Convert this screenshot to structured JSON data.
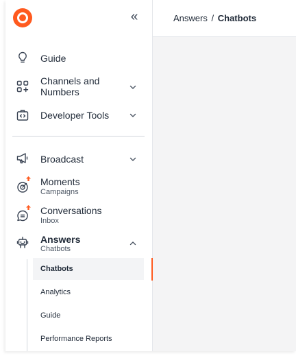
{
  "header": {
    "breadcrumb_parent": "Answers",
    "breadcrumb_separator": "/",
    "breadcrumb_current": "Chatbots"
  },
  "sidebar": {
    "collapse_glyph": "«",
    "items": [
      {
        "label": "Guide",
        "icon": "lightbulb-icon"
      },
      {
        "label": "Channels and Numbers",
        "icon": "grid-plus-icon",
        "expandable": true
      },
      {
        "label": "Developer Tools",
        "icon": "code-box-icon",
        "expandable": true
      },
      {
        "label": "Broadcast",
        "icon": "megaphone-icon",
        "expandable": true
      },
      {
        "label": "Moments",
        "sublabel": "Campaigns",
        "icon": "target-icon",
        "badge": "upgrade-arrow"
      },
      {
        "label": "Conversations",
        "sublabel": "Inbox",
        "icon": "chat-bubble-icon",
        "badge": "upgrade-arrow"
      },
      {
        "label": "Answers",
        "sublabel": "Chatbots",
        "icon": "robot-icon",
        "expanded": true
      }
    ],
    "answers_children": [
      {
        "label": "Chatbots",
        "active": true
      },
      {
        "label": "Analytics"
      },
      {
        "label": "Guide"
      },
      {
        "label": "Performance Reports"
      }
    ]
  },
  "colors": {
    "accent": "#ff5a1f",
    "active_bg": "#f3f4f6",
    "main_bg": "#f4f4f5"
  }
}
